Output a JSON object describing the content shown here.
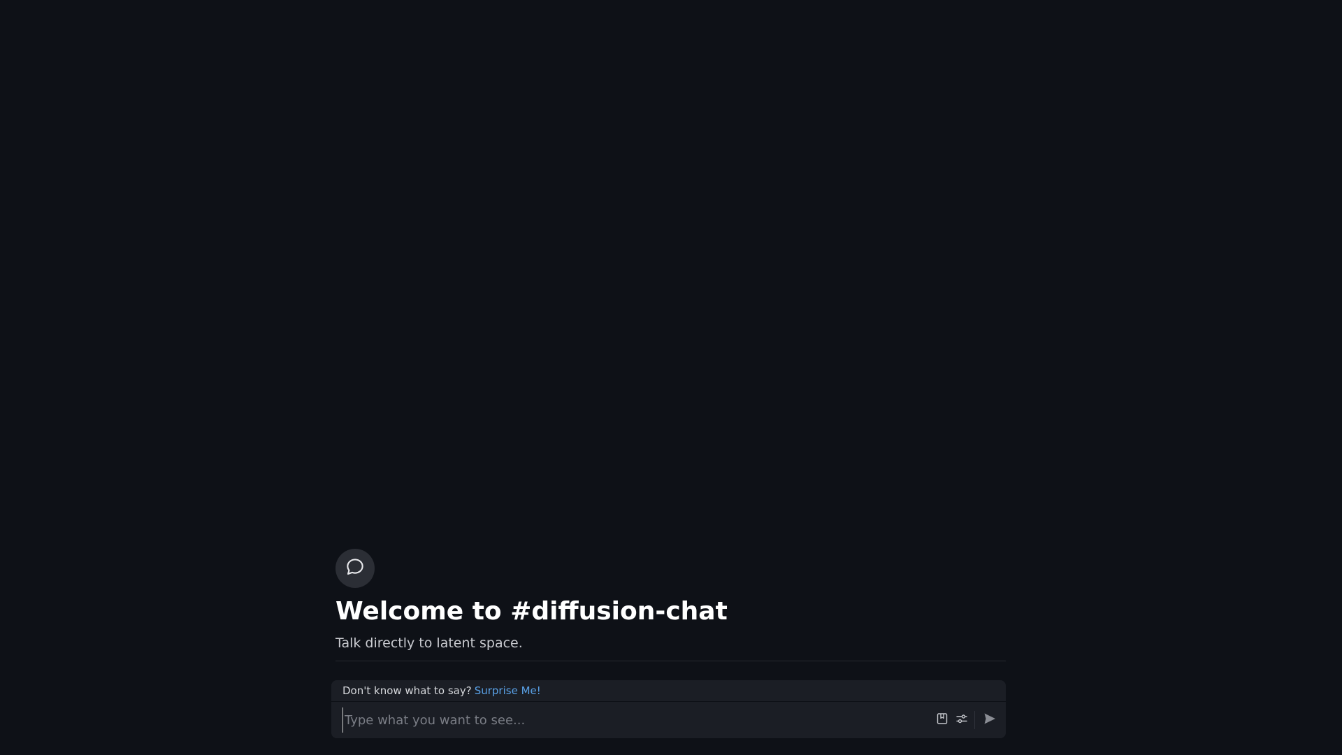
{
  "channel": {
    "icon": "chat-bubble-icon",
    "welcome_title": "Welcome to #diffusion-chat",
    "welcome_subtitle": "Talk directly to latent space."
  },
  "composer": {
    "suggest_prompt": "Don't know what to say?",
    "suggest_link": "Surprise Me!",
    "input_placeholder": "Type what you want to see...",
    "input_value": "",
    "tools": [
      {
        "icon": "bookmark-icon"
      },
      {
        "icon": "sliders-icon"
      },
      {
        "icon": "send-icon"
      }
    ]
  },
  "colors": {
    "background": "#0e1117",
    "composer_bg": "#1b1e25",
    "link": "#5aa2e8",
    "icon_circle": "#2b2e35"
  }
}
